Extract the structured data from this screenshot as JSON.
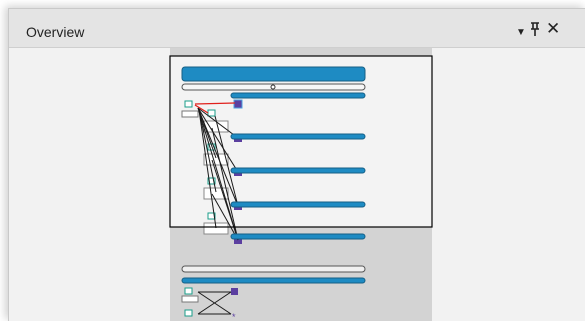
{
  "panel": {
    "title": "Overview",
    "controls": {
      "dropdown_icon": "triangle-down",
      "pin_icon": "pin",
      "close_icon": "close-x"
    }
  },
  "colors": {
    "workflow_bar": "#1e8bc3",
    "connector_red": "#e0201c",
    "connector_black": "#1a1a1a",
    "node_teal": "#1a9c8a",
    "node_purple": "#5b3fa0",
    "gray_region": "#d3d3d3",
    "viewport_border": "#000000"
  }
}
